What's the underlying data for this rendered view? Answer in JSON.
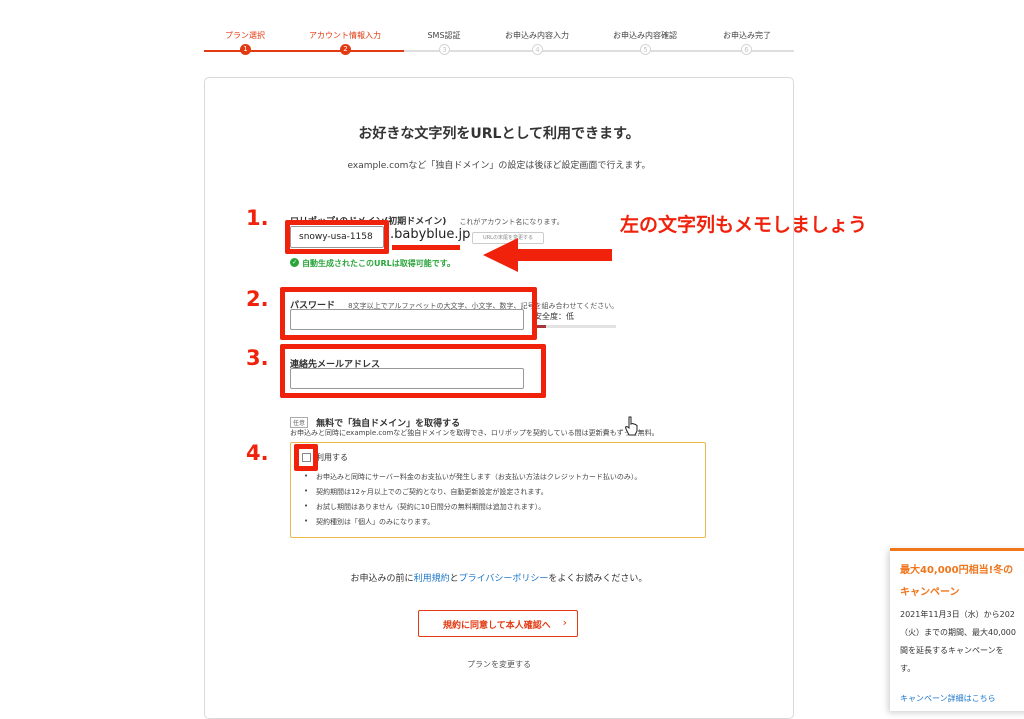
{
  "stepper": {
    "steps": [
      {
        "label": "プラン選択",
        "num": "1",
        "active": true
      },
      {
        "label": "アカウント情報入力",
        "num": "2",
        "active": true
      },
      {
        "label": "SMS認証",
        "num": "3",
        "active": false
      },
      {
        "label": "お申込み内容入力",
        "num": "4",
        "active": false
      },
      {
        "label": "お申込み内容確認",
        "num": "5",
        "active": false
      },
      {
        "label": "お申込み完了",
        "num": "6",
        "active": false
      }
    ]
  },
  "header": {
    "title": "お好きな文字列をURLとして利用できます。",
    "subtitle": "example.comなど「独自ドメイン」の設定は後ほど設定画面で行えます。"
  },
  "domain": {
    "label": "ロリポップ!のドメイン(初期ドメイン)",
    "hint": "これがアカウント名になります。",
    "value": "snowy-usa-1158",
    "suffix": ".babyblue.jp",
    "change_suffix_label": "URLの末尾を変更する",
    "available_msg": "自動生成されたこのURLは取得可能です。"
  },
  "password": {
    "label": "パスワード",
    "hint": "8文字以上でアルファベットの大文字、小文字、数字、記号を組み合わせてください。",
    "value": "",
    "strength_label": "安全度：",
    "strength_value": "低",
    "strength_level": 0.15
  },
  "email": {
    "label": "連絡先メールアドレス",
    "value": ""
  },
  "free_domain": {
    "tag": "任意",
    "title": "無料で「独自ドメイン」を取得する",
    "desc": "お申込みと同時にexample.comなど独自ドメインを取得でき、ロリポップを契約している間は更新費もずっと無料。",
    "checkbox_label": "利用する",
    "checked": false,
    "bullets": [
      "お申込みと同時にサーバー料金のお支払いが発生します（お支払い方法はクレジットカード払いのみ）。",
      "契約期間は12ヶ月以上でのご契約となり、自動更新設定が設定されます。",
      "お試し期間はありません（契約に10日間分の無料期間は追加されます）。",
      "契約種別は「個人」のみになります。"
    ]
  },
  "terms": {
    "prefix": "お申込みの前に",
    "terms_link": "利用規約",
    "and": "と",
    "privacy_link": "プライバシーポリシー",
    "suffix": "をよくお読みください。"
  },
  "actions": {
    "submit_label": "規約に同意して本人確認へ",
    "submit_arrow": "›",
    "change_plan_label": "プランを変更する"
  },
  "annotations": {
    "num1": "1.",
    "num2": "2.",
    "num3": "3.",
    "num4": "4.",
    "memo": "左の文字列もメモしましょう"
  },
  "campaign": {
    "title_line1": "最大40,000円相当!冬の",
    "title_line2": "キャンペーン",
    "body_line1": "2021年11月3日（水）から202",
    "body_line2": "（火）までの期間、最大40,000",
    "body_line3": "間を延長するキャンペーンを",
    "body_line4": "す。",
    "link": "キャンペーン詳細はこちら"
  },
  "colors": {
    "accent": "#e23a12",
    "annotation_red": "#f0220c",
    "link": "#1a76c9",
    "success": "#2aa53b",
    "campaign_orange": "#f0761c"
  }
}
